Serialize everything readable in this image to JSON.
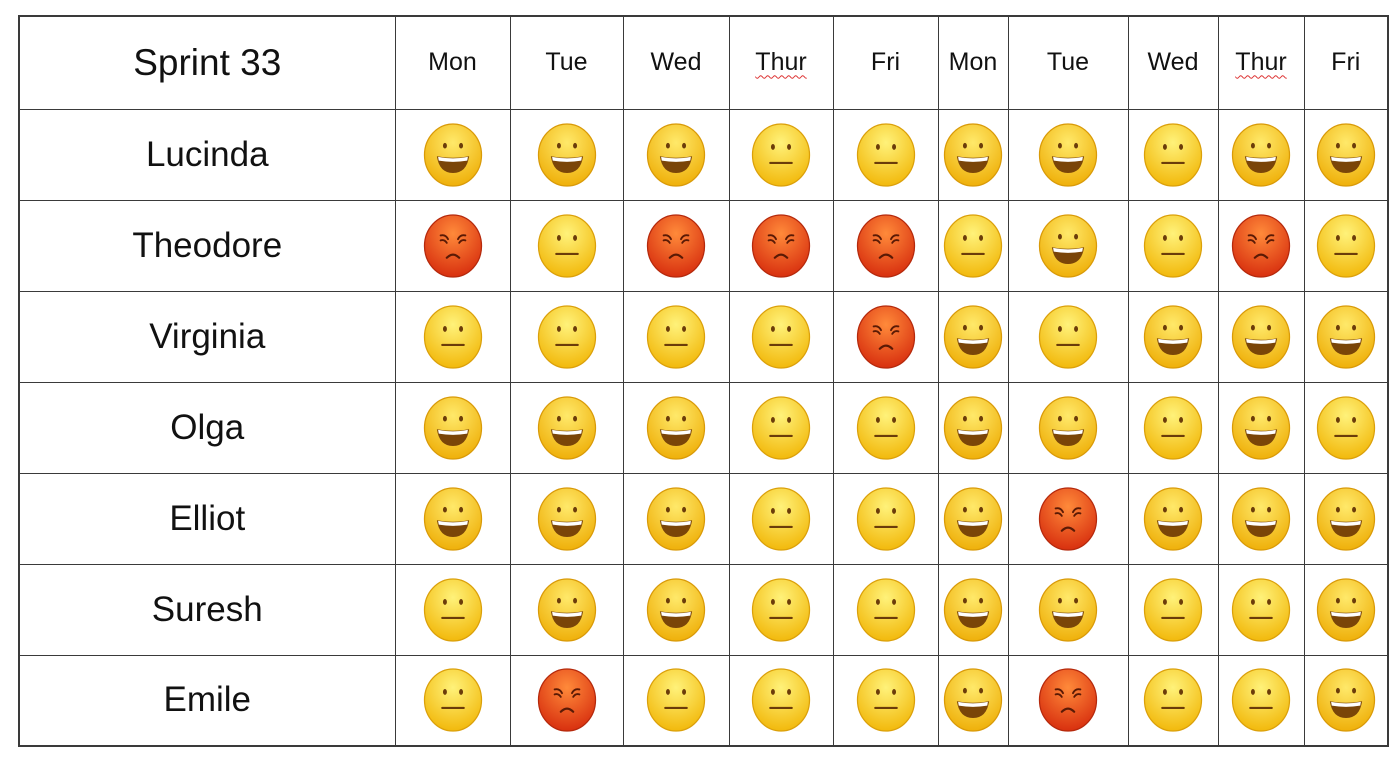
{
  "table": {
    "title": "Sprint 33",
    "days": [
      {
        "label": "Mon",
        "spellcheck": false
      },
      {
        "label": "Tue",
        "spellcheck": false
      },
      {
        "label": "Wed",
        "spellcheck": false
      },
      {
        "label": "Thur",
        "spellcheck": true
      },
      {
        "label": "Fri",
        "spellcheck": false
      },
      {
        "label": "Mon",
        "spellcheck": false
      },
      {
        "label": "Tue",
        "spellcheck": false
      },
      {
        "label": "Wed",
        "spellcheck": false
      },
      {
        "label": "Thur",
        "spellcheck": true
      },
      {
        "label": "Fri",
        "spellcheck": false
      }
    ],
    "mood_legend": {
      "happy": "grinning-face",
      "neutral": "neutral-face",
      "angry": "angry-face"
    },
    "colors": {
      "happy": "#f5c518",
      "neutral": "#f7cf1e",
      "angry": "#e8491c",
      "border": "#3a3a3a"
    },
    "rows": [
      {
        "name": "Lucinda",
        "moods": [
          "happy",
          "happy",
          "happy",
          "neutral",
          "neutral",
          "happy",
          "happy",
          "neutral",
          "happy",
          "happy"
        ]
      },
      {
        "name": "Theodore",
        "moods": [
          "angry",
          "neutral",
          "angry",
          "angry",
          "angry",
          "neutral",
          "happy",
          "neutral",
          "angry",
          "neutral"
        ]
      },
      {
        "name": "Virginia",
        "moods": [
          "neutral",
          "neutral",
          "neutral",
          "neutral",
          "angry",
          "happy",
          "neutral",
          "happy",
          "happy",
          "happy"
        ]
      },
      {
        "name": "Olga",
        "moods": [
          "happy",
          "happy",
          "happy",
          "neutral",
          "neutral",
          "happy",
          "happy",
          "neutral",
          "happy",
          "neutral"
        ]
      },
      {
        "name": "Elliot",
        "moods": [
          "happy",
          "happy",
          "happy",
          "neutral",
          "neutral",
          "happy",
          "angry",
          "happy",
          "happy",
          "happy"
        ]
      },
      {
        "name": "Suresh",
        "moods": [
          "neutral",
          "happy",
          "happy",
          "neutral",
          "neutral",
          "happy",
          "happy",
          "neutral",
          "neutral",
          "happy"
        ]
      },
      {
        "name": "Emile",
        "moods": [
          "neutral",
          "angry",
          "neutral",
          "neutral",
          "neutral",
          "happy",
          "angry",
          "neutral",
          "neutral",
          "happy"
        ]
      }
    ]
  }
}
